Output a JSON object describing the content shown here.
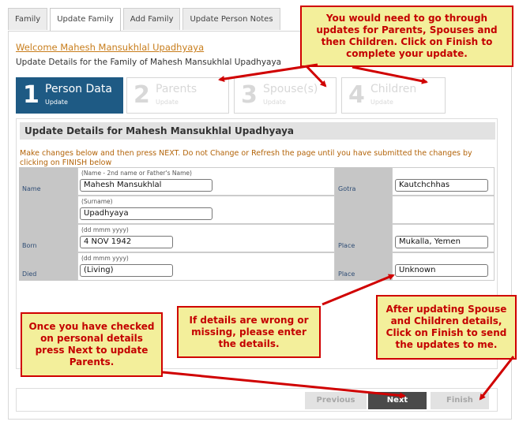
{
  "tabs": [
    {
      "label": "Family"
    },
    {
      "label": "Update Family"
    },
    {
      "label": "Add Family"
    },
    {
      "label": "Update Person Notes"
    }
  ],
  "welcome": "Welcome Mahesh Mansukhlal Upadhyaya",
  "subtitle": "Update Details for the Family of Mahesh Mansukhlal Upadhyaya",
  "steps": [
    {
      "num": "1",
      "title": "Person Data",
      "sub": "Update"
    },
    {
      "num": "2",
      "title": "Parents",
      "sub": "Update"
    },
    {
      "num": "3",
      "title": "Spouse(s)",
      "sub": "Update"
    },
    {
      "num": "4",
      "title": "Children",
      "sub": "Update"
    }
  ],
  "panel": {
    "title": "Update Details for Mahesh Mansukhlal Upadhyaya",
    "instructions": "Make changes below and then press NEXT. Do not Change or Refresh the page until you have submitted the changes by clicking on FINISH below"
  },
  "form": {
    "name_label": "Name",
    "name_hint": "(Name - 2nd name or Father's Name)",
    "name_value": "Mahesh Mansukhlal",
    "surname_hint": "(Surname)",
    "surname_value": "Upadhyaya",
    "gotra_label": "Gotra",
    "gotra_value": "Kautchchhas",
    "born_label": "Born",
    "born_hint": "(dd mmm yyyy)",
    "born_value": "4 NOV 1942",
    "place_label": "Place",
    "born_place_value": "Mukalla, Yemen",
    "died_label": "Died",
    "died_hint": "(dd mmm yyyy)",
    "died_value": " (Living)",
    "died_place_label": "Place",
    "died_place_value": "Unknown"
  },
  "buttons": {
    "previous": "Previous",
    "next": "Next",
    "finish": "Finish"
  },
  "callouts": {
    "top": "You would need to go through updates for Parents, Spouses and then Children. Click on Finish to complete your update.",
    "left": "Once you have checked on personal details press Next to update Parents.",
    "middle": "If details are wrong or missing, please enter the details.",
    "right": "After updating Spouse and Children details, Click on Finish to send the updates to me."
  },
  "colors": {
    "accent": "#1e5a84",
    "callout_bg": "#f3ef9b",
    "callout_border": "#d00000",
    "callout_text": "#c40000"
  }
}
